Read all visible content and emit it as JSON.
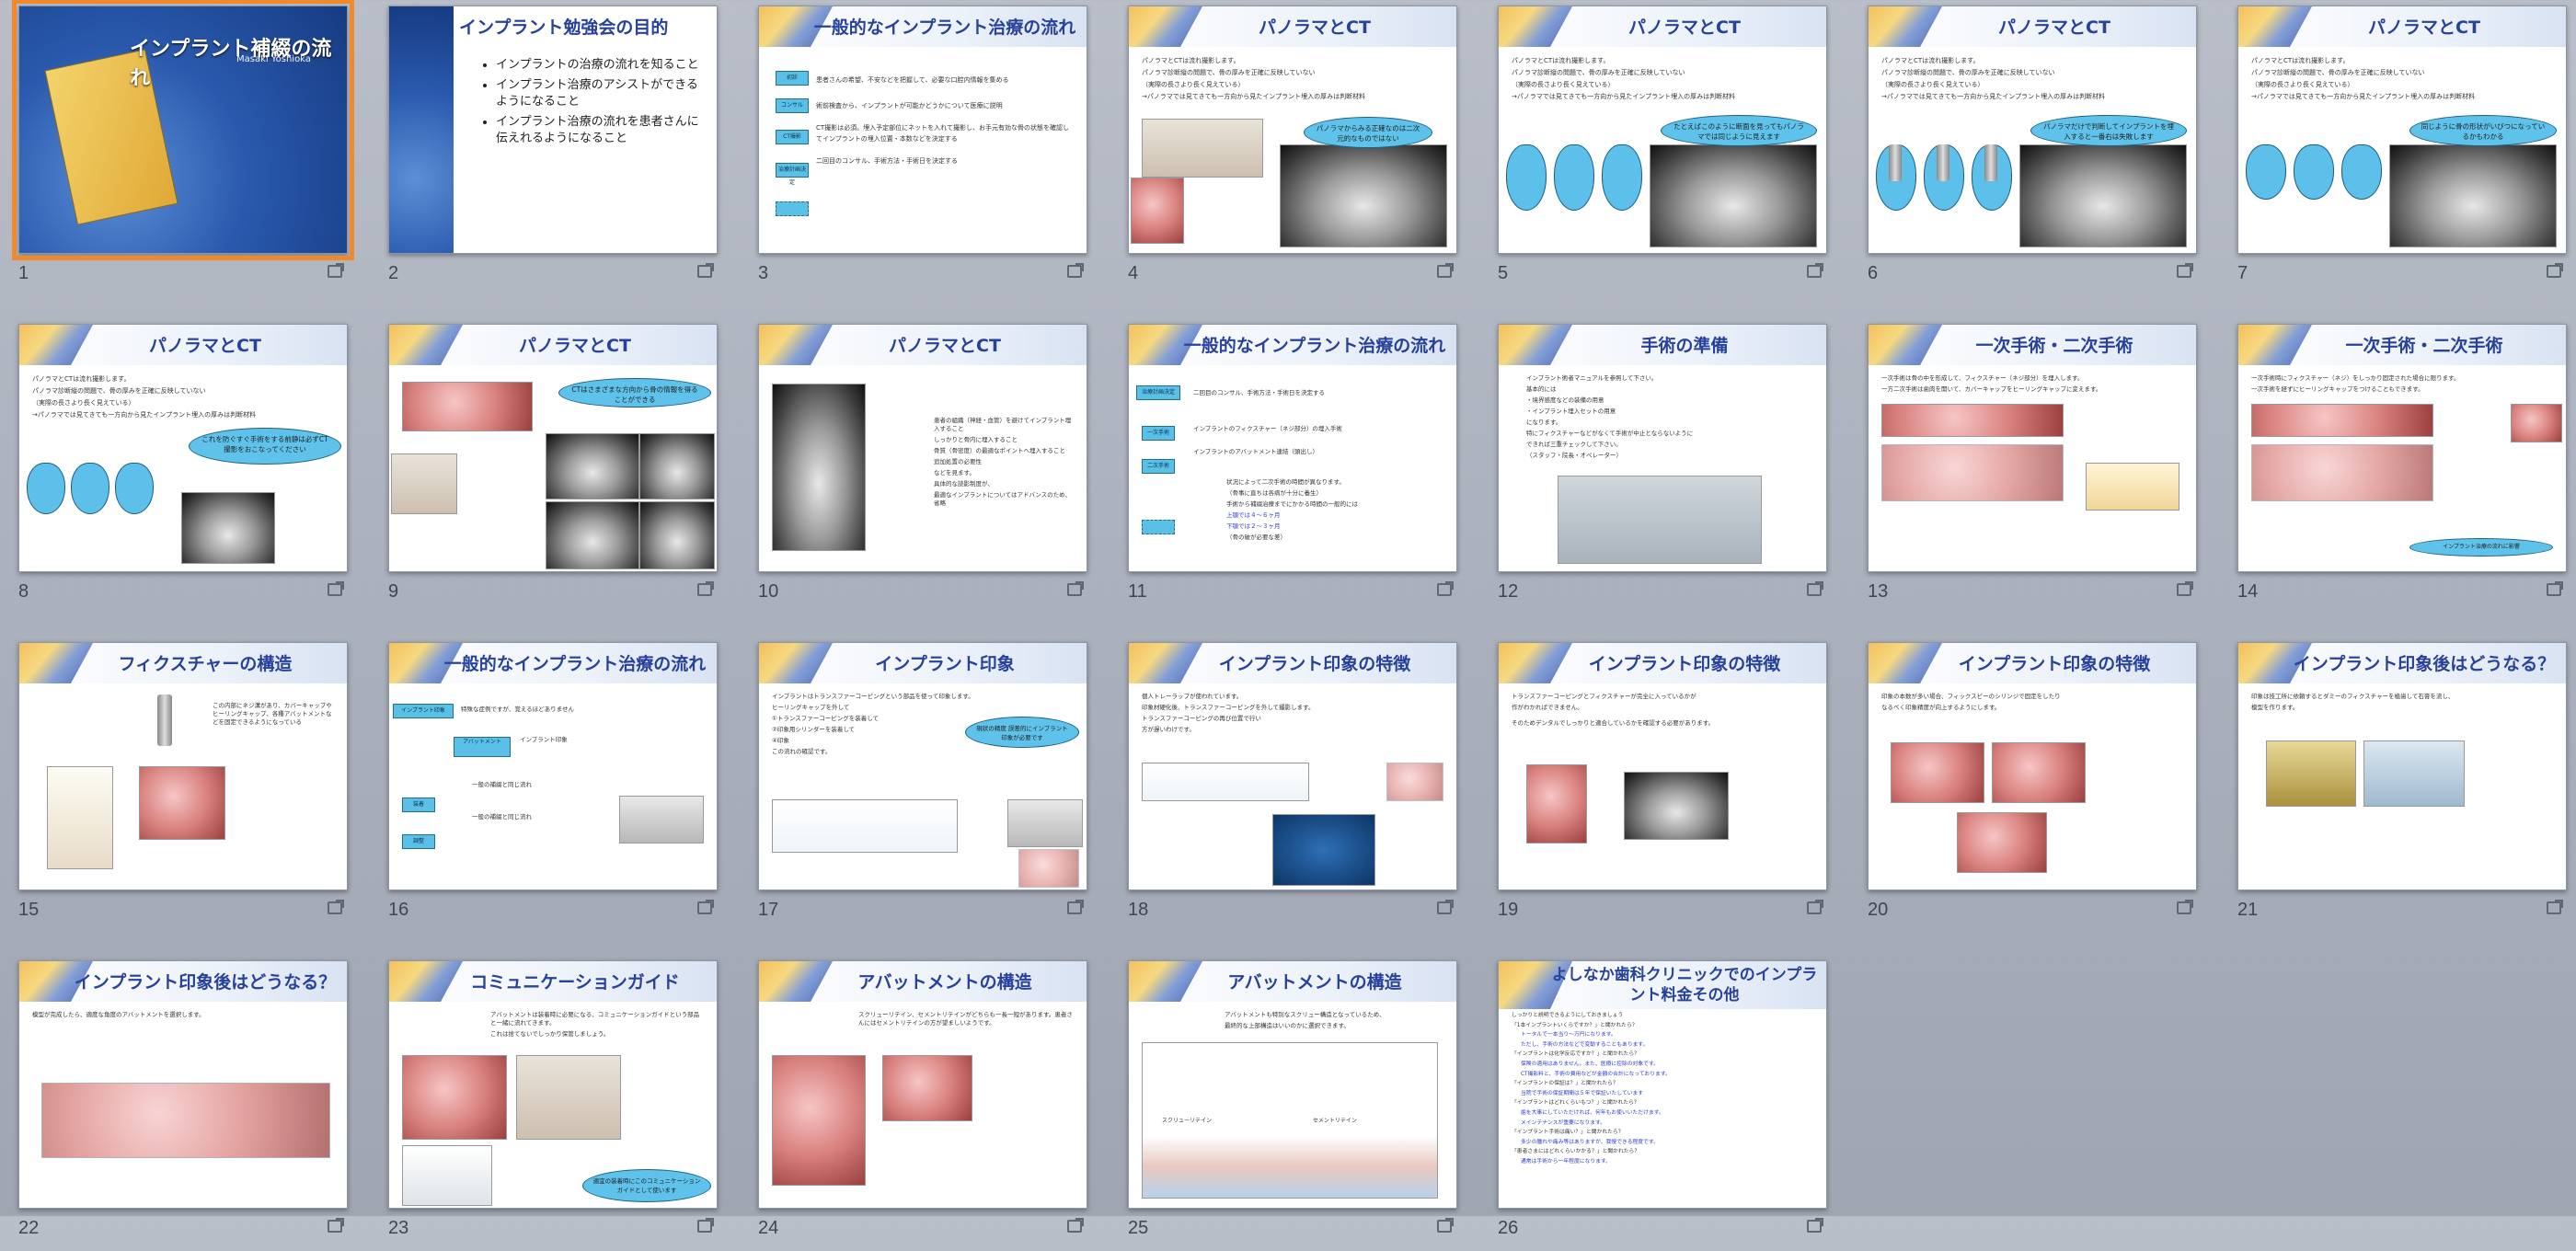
{
  "window": {
    "title": "インプラント補綴の流れ"
  },
  "slides": [
    {
      "n": "1",
      "title": "インプラント補綴の流れ",
      "author": "Masaki  Yoshioka",
      "selected": true
    },
    {
      "n": "2",
      "title": "インプラント勉強会の目的",
      "items": [
        "インプラントの治療の流れを知ること",
        "インプラント治療のアシストができるようになること",
        "インプラント治療の流れを患者さんに伝えれるようになること"
      ]
    },
    {
      "n": "3",
      "title": "一般的なインプラント治療の流れ",
      "body": [
        "患者さんの希望、不安などを把握して、必要な口腔内情報を集める",
        "術前検査から、インプラントが可能かどうかについて医療に説明",
        "CT撮影は必須。埋入予定部位にネットを入れて撮影し、お手元有効な骨の状態を確認してインプラントの埋入位置・本数などを決定する",
        "二回目のコンサル、手術方法・手術日を決定する"
      ],
      "flow": [
        "初診",
        "コンサル",
        "CT撮影",
        "治療計画決定",
        ""
      ]
    },
    {
      "n": "4",
      "title": "パノラマとCT",
      "body": [
        "パノラマとCTは流れ撮影します。",
        "パノラマ診断縦の問題で、骨の厚みを正確に反映していない",
        "（実際の長さより長く見えている）",
        "→パノラマでは見てきても一方向から見たインプラント埋入の厚みは判断材料"
      ],
      "callout": "パノラマからみる正確なのは二次元的なものではない"
    },
    {
      "n": "5",
      "title": "パノラマとCT",
      "body": [
        "パノラマとCTは流れ撮影します。",
        "パノラマ診断縦の問題で、骨の厚みを正確に反映していない",
        "（実際の長さより長く見えている）",
        "→パノラマでは見てきても一方向から見たインプラント埋入の厚みは判断材料"
      ],
      "callout": "たとえばこのように断面を見ってもパノラマでは同じように見えます"
    },
    {
      "n": "6",
      "title": "パノラマとCT",
      "body": [
        "パノラマとCTは流れ撮影します。",
        "パノラマ診断縦の問題で、骨の厚みを正確に反映していない",
        "（実際の長さより長く見えている）",
        "→パノラマでは見てきても一方向から見たインプラント埋入の厚みは判断材料"
      ],
      "callout": "パノラマだけで判断してインプラントを埋入すると一番右は失敗します"
    },
    {
      "n": "7",
      "title": "パノラマとCT",
      "body": [
        "パノラマとCTは流れ撮影します。",
        "パノラマ診断縦の問題で、骨の厚みを正確に反映していない",
        "（実際の長さより長く見えている）",
        "→パノラマでは見てきても一方向から見たインプラント埋入の厚みは判断材料"
      ],
      "callout": "同じように骨の形状がいびつになっているかもわかる"
    },
    {
      "n": "8",
      "title": "パノラマとCT",
      "body": [
        "パノラマとCTは流れ撮影します。",
        "パノラマ診断縦の問題で、骨の厚みを正確に反映していない",
        "（実際の長さより長く見えている）",
        "→パノラマでは見てきても一方向から見たインプラント埋入の厚みは判断材料"
      ],
      "callout": "これを防ぐすぐ手術をする前静は必ずCT撮影をおこなってください"
    },
    {
      "n": "9",
      "title": "パノラマとCT",
      "callout": "CTはさまざまな方向から骨の情報を得ることができる"
    },
    {
      "n": "10",
      "title": "パノラマとCT",
      "body": [
        "患者の組織（神経・血管）を避けてインプラント埋入すること",
        "しっかりと骨内に埋入すること",
        "骨質（骨密度）の最適なポイントへ埋入すること",
        "追加処置の必要性",
        "などを見ます。",
        "具体的な読影制度が、",
        "最適なインプラントについてはアドバンスのため、省略"
      ]
    },
    {
      "n": "11",
      "title": "一般的なインプラント治療の流れ",
      "body": [
        "二回目のコンサル、手術方法・手術日を決定する",
        "インプラントのフィクスチャー（ネジ部分）の埋入手術",
        "インプラントのアバットメント連結（頭出し）",
        "状況によって二次手術の時間が異なります。",
        "（骨事に直ちは各病が十分に養生）",
        "手術から補綴治療までにかかる時間の一般的には",
        "上顎では４～６ヶ月",
        "下顎では２～３ヶ月",
        "（骨の破が必要な差）"
      ],
      "flow": [
        "治療計画決定",
        "一次手術",
        "二次手術",
        ""
      ]
    },
    {
      "n": "12",
      "title": "手術の準備",
      "body": [
        "インプラント術者マニュアルを参照して下さい。",
        "基本的には",
        "・境界感度などの装備の用意",
        "・インプラント埋入セットの用意",
        "になります。",
        "特にフィクスチャーなどがなくて手術が中止とならないように",
        "できれば三重チェックして下さい。",
        "（スタッフ・院長・オペレーター）"
      ]
    },
    {
      "n": "13",
      "title": "一次手術・二次手術",
      "body": [
        "一次手術は骨の中を形成して、フィクスチャー（ネジ部分）を埋入します。",
        "一方二次手術は歯肉を開いて、カバーキャップをヒーリングキャップに変えます。"
      ]
    },
    {
      "n": "14",
      "title": "一次手術・二次手術",
      "body": [
        "一次手術時にフィクスチャー（ネジ）をしっかり固定された場合に限ります。",
        "一次手術を経ずにヒーリングキャップをつけることもできます。"
      ],
      "callout": "インプラント治療の流れに影響"
    },
    {
      "n": "15",
      "title": "フィクスチャーの構造",
      "body": [
        "この内部にネジ溝があり、カバーキャップやヒーリングキャップ、各種アバットメントなどを固定できるようになっている"
      ]
    },
    {
      "n": "16",
      "title": "一般的なインプラント治療の流れ",
      "body": [
        "特殊な症例ですが、覚えるほどありません",
        "インプラント印象",
        "一般の補綴と同じ流れ",
        "一般の補綴と同じ流れ"
      ],
      "flow": [
        "インプラント印象",
        "アバットメント",
        "装着",
        "調整"
      ]
    },
    {
      "n": "17",
      "title": "インプラント印象",
      "body": [
        "インプラントはトランスファーコーピングという部品を使って印象します。",
        "ヒーリングキャップを外して",
        "①トランスファーコーピングを装着して",
        "②印象用シリンダーを装着して",
        "④印象",
        "この流れの確認です。"
      ],
      "callout": "現状の精度 誤差的にインプラント印象が必要です"
    },
    {
      "n": "18",
      "title": "インプラント印象の特徴",
      "body": [
        "個人トレーラップが使われています。",
        "印象材硬化後、トランスファーコーピングを外して撮影します。",
        "トランスファーコーピングの再び位置で行い",
        "方が遅いわけです。"
      ]
    },
    {
      "n": "19",
      "title": "インプラント印象の特徴",
      "body": [
        "トランスファーコーピングとフィクスチャーが完全に入っているかが",
        "作がわかればできません。",
        "そのためデンタルでしっかりと適合しているかを確認する必要があります。"
      ]
    },
    {
      "n": "20",
      "title": "インプラント印象の特徴",
      "body": [
        "印象の本数が多い場合、フィックスピーのシリンジで固定をしたり",
        "なるべく印象精度が向上するようにします。"
      ]
    },
    {
      "n": "21",
      "title": "インプラント印象後はどうなる？",
      "body": [
        "印象は技工所に依頼するとダミーのフィクスチャーを植歯して石膏を流し、",
        "模型を作ります。"
      ]
    },
    {
      "n": "22",
      "title": "インプラント印象後はどうなる？",
      "body": [
        "模型が完成したら、適度な角度のアバットメントを選択します。"
      ]
    },
    {
      "n": "23",
      "title": "コミュニケーションガイド",
      "body": [
        "アバットメントは装着時に必要になる、コミュニケーションガイドという部品と一緒に流れてきます。",
        "これは捨てないでしっかり保管しましょう。"
      ],
      "callout": "適宜の装着時にこのコミュニケーションガイドとして使います"
    },
    {
      "n": "24",
      "title": "アバットメントの構造",
      "body": [
        "スクリューリテイン、セメントリテインがどちらも一長一短があります。患者さんにはセメントリテインの方が望ましいようです。"
      ]
    },
    {
      "n": "25",
      "title": "アバットメントの構造",
      "body": [
        "アバットメントも特別なスクリュー構造となっているため、",
        "最終的な上部構造はいいのかに選択できます。"
      ],
      "labels": [
        "スクリューリテイン",
        "セメントリテイン"
      ]
    },
    {
      "n": "26",
      "title": "よしなか歯科クリニックでのインプラント料金その他",
      "body": [
        "しっかりと説明できるようにしておきましょう",
        "「1本インプラントいくらですか？」と聞かれたら？",
        "トータルで一本当り～万円になります。",
        "ただし、手術の方法などで変動することもあります。",
        "「インプラントは化学反応ですか？」と聞かれたら？",
        "保険の適用はありません。また、医療に控除の対象です。",
        "CT撮影料と、手術の費用などが金額の合計になっております。",
        "「インプラントの保証は？」と聞かれたら？",
        "当院で手術の保証期間は５年で保証いたしています",
        "「インプラントはどれくらいもつ？」と聞かれたら？",
        "歯を大事にしていただければ、何年もお使いいただけます。",
        "メインテナンスが重要になります。",
        "「インプラント手術は痛い？」と聞かれたら？",
        "多少の腫れや痛み等はありますが、我慢できる程度です。",
        "「患者さまにはどれくらいかかる？」と聞かれたら？",
        "通常は手術から一年程度になります。"
      ]
    }
  ]
}
